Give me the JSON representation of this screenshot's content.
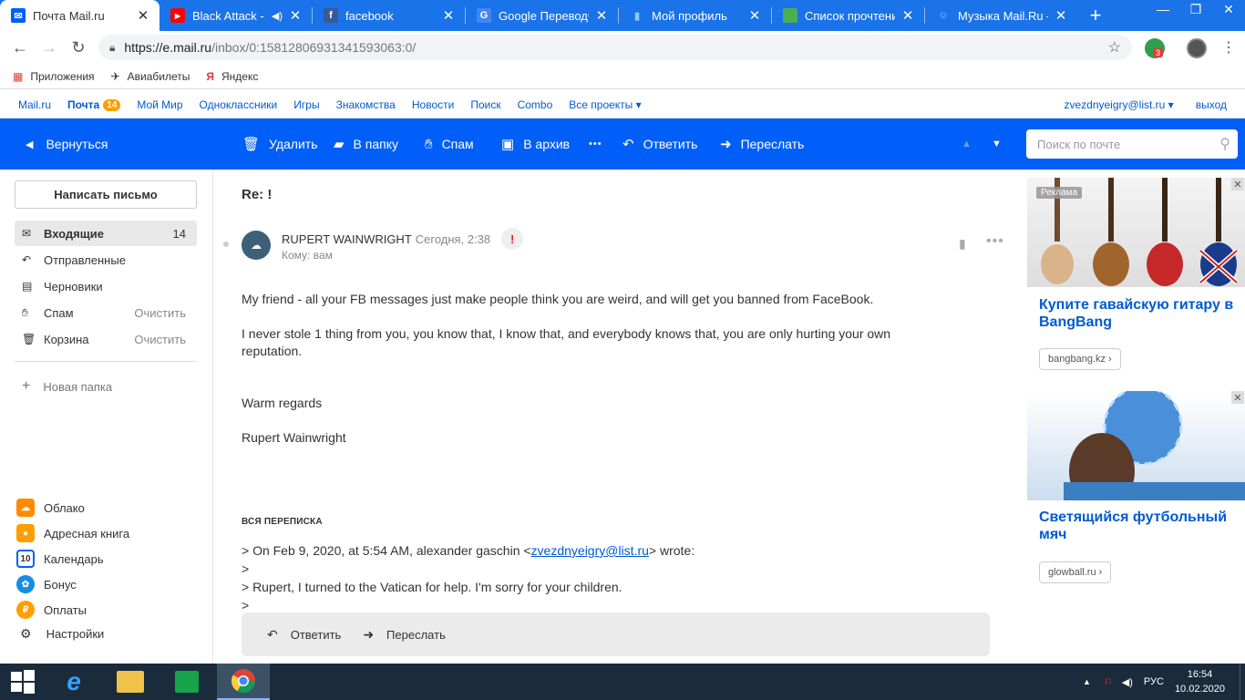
{
  "browser": {
    "tabs": [
      {
        "title": "Почта Mail.ru",
        "icon": "mail-icon",
        "active": true
      },
      {
        "title": "Black Attack - ",
        "icon": "youtube-icon"
      },
      {
        "title": "facebook",
        "icon": "facebook-icon"
      },
      {
        "title": "Google Переводчи",
        "icon": "google-translate-icon"
      },
      {
        "title": "Мой профиль",
        "icon": "book-icon"
      },
      {
        "title": "Список прочтений",
        "icon": "list-icon"
      },
      {
        "title": "Музыка Mail.Ru – ",
        "icon": "music-icon"
      }
    ],
    "new_tab": "+",
    "window_buttons": [
      "—",
      "❐",
      "✕"
    ],
    "url_main": "https://e.mail.ru",
    "url_rest": "/inbox/0:15812806931341593063:0/",
    "ext_badge": "3",
    "bookmarks": [
      {
        "label": "Приложения",
        "icon": "apps-icon"
      },
      {
        "label": "Авиабилеты",
        "icon": "plane-icon"
      },
      {
        "label": "Яндекс",
        "icon": "yandex-icon"
      }
    ]
  },
  "portal": {
    "links": [
      "Mail.ru",
      "Почта",
      "Мой Мир",
      "Одноклассники",
      "Игры",
      "Знакомства",
      "Новости",
      "Поиск",
      "Combo",
      "Все проекты ▾"
    ],
    "mail_badge": "14",
    "user": "zvezdnyeigry@list.ru ▾",
    "logout": "выход"
  },
  "toolbar": {
    "back": "Вернуться",
    "delete": "Удалить",
    "to_folder": "В папку",
    "spam": "Спам",
    "archive": "В архив",
    "more": "•••",
    "reply": "Ответить",
    "forward": "Переслать",
    "search_placeholder": "Поиск по почте"
  },
  "sidebar": {
    "compose": "Написать письмо",
    "folders": [
      {
        "name": "Входящие",
        "count": "14",
        "icon": "inbox-icon"
      },
      {
        "name": "Отправленные",
        "count": "",
        "icon": "sent-icon"
      },
      {
        "name": "Черновики",
        "count": "",
        "icon": "drafts-icon"
      },
      {
        "name": "Спам",
        "count": "Очистить",
        "icon": "spam-icon"
      },
      {
        "name": "Корзина",
        "count": "Очистить",
        "icon": "trash-icon"
      }
    ],
    "new_folder": "Новая папка",
    "services": [
      {
        "name": "Облако",
        "color": "#ff8a00"
      },
      {
        "name": "Адресная книга",
        "color": "#ff9e00"
      },
      {
        "name": "Календарь",
        "color": "#005ff9"
      },
      {
        "name": "Бонус",
        "color": "#168de2"
      },
      {
        "name": "Оплаты",
        "color": "#ff9e00"
      },
      {
        "name": "Настройки",
        "color": "#333333"
      }
    ],
    "calendar_day": "10"
  },
  "message": {
    "subject": "Re: !",
    "sender": "RUPERT WAINWRIGHT",
    "date": "Сегодня, 2:38",
    "to": "Кому: вам",
    "paragraphs": [
      "My friend - all your FB messages just make people think you are weird, and will get you banned from FaceBook.",
      "I never stole 1 thing from you, you know that, I know that, and everybody knows that, you are only hurting your own reputation.",
      "Warm regards",
      "Rupert Wainwright"
    ],
    "thread_label": "ВСЯ ПЕРЕПИСКА",
    "quote_prefix": "> On Feb 9, 2020, at 5:54 AM, alexander gaschin <",
    "quote_email": "zvezdnyeigry@list.ru",
    "quote_suffix": "> wrote:",
    "quote_lines": [
      ">",
      "> Rupert, I turned to the Vatican for help. I'm sorry for your children.",
      ">"
    ],
    "reply": "Ответить",
    "forward": "Переслать"
  },
  "ads": {
    "label": "Реклама",
    "items": [
      {
        "title": "Купите гавайскую гитару в BangBang",
        "link": "bangbang.kz ›"
      },
      {
        "title": "Светящийся футбольный мяч",
        "link": "glowball.ru ›"
      }
    ]
  },
  "taskbar": {
    "lang": "РУС",
    "time": "16:54",
    "date": "10.02.2020"
  }
}
